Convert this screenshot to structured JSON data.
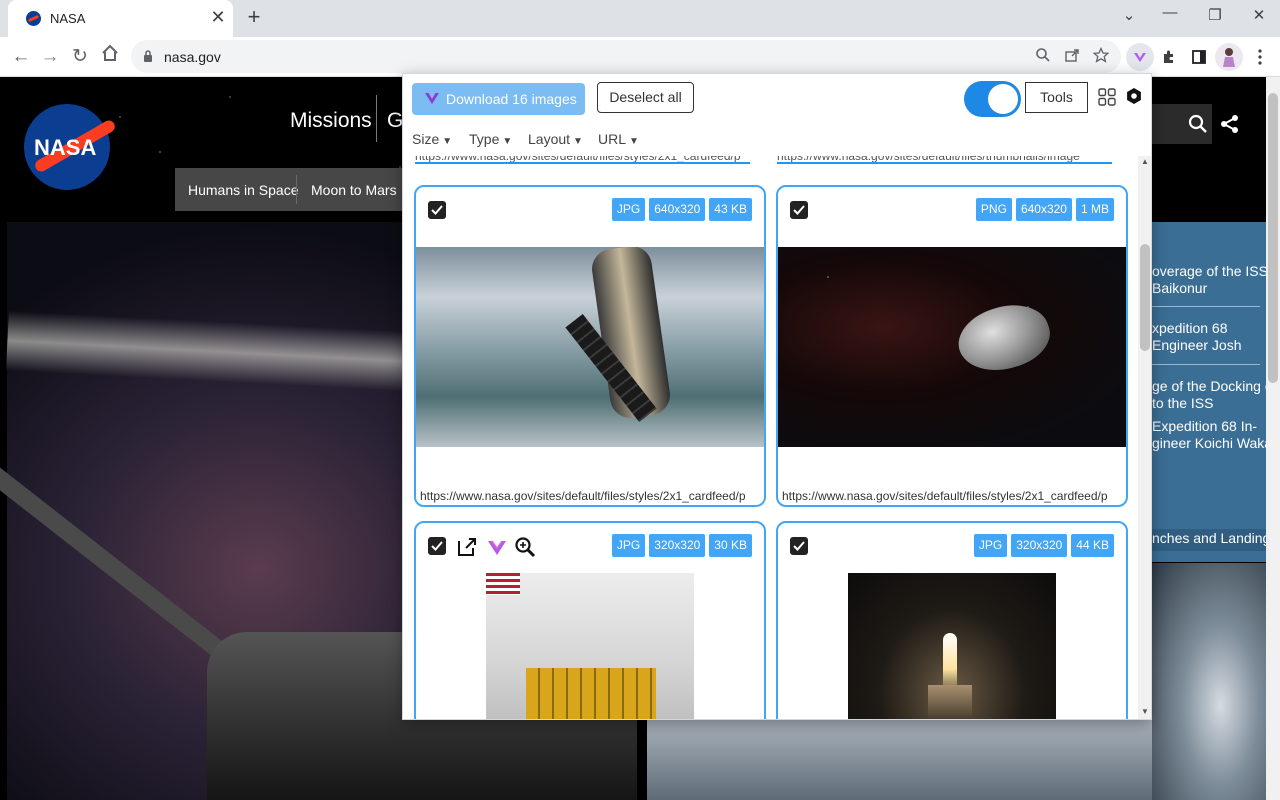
{
  "browser": {
    "tab": {
      "title": "NASA",
      "close_glyph": "✕"
    },
    "new_tab_glyph": "+",
    "window_controls": {
      "tabs_menu": "⌄",
      "minimize": "—",
      "maximize": "❐",
      "close": "✕"
    },
    "nav": {
      "back": "←",
      "forward": "→",
      "reload": "↻"
    },
    "url": "nasa.gov"
  },
  "page": {
    "logo_text": "NASA",
    "main_nav": [
      "Missions",
      "G"
    ],
    "sub_nav": [
      "Humans in Space",
      "Moon to Mars"
    ],
    "sidebar_headlines": [
      [
        "overage of the ISS",
        " Baikonur"
      ],
      [
        "xpedition 68",
        "Engineer Josh"
      ],
      [
        "ge of the Docking of",
        "to the ISS"
      ],
      [
        " Expedition 68 In-",
        "gineer Koichi Wakata"
      ]
    ],
    "launches_link": "nches and Landings"
  },
  "extension": {
    "download_button": "Download 16 images",
    "deselect_button": "Deselect all",
    "toggle_on": true,
    "tools_button": "Tools",
    "filters": [
      "Size",
      "Type",
      "Layout",
      "URL"
    ],
    "images": [
      {
        "checked": true,
        "type": "JPG",
        "dims": "640x320",
        "size": "43 KB",
        "url": "https://www.nasa.gov/sites/default/files/styles/2x1_cardfeed/p",
        "subject": "soyuz-spacecraft"
      },
      {
        "checked": true,
        "type": "PNG",
        "dims": "640x320",
        "size": "1 MB",
        "url": "https://www.nasa.gov/sites/default/files/styles/2x1_cardfeed/p",
        "subject": "asteroid"
      },
      {
        "checked": true,
        "type": "JPG",
        "dims": "320x320",
        "size": "30 KB",
        "url": "",
        "subject": "spacecraft-module-in-cleanroom",
        "hover_actions": [
          "open-external-icon",
          "download-logo-icon",
          "zoom-icon"
        ]
      },
      {
        "checked": true,
        "type": "JPG",
        "dims": "320x320",
        "size": "44 KB",
        "url": "",
        "subject": "rocket-launch"
      }
    ]
  },
  "colors": {
    "accent": "#42a5f5",
    "download_button": "#7bbcf2",
    "toggle": "#1e88e5",
    "nasa_blue": "#0b3d91",
    "nasa_red": "#fc3d21"
  }
}
